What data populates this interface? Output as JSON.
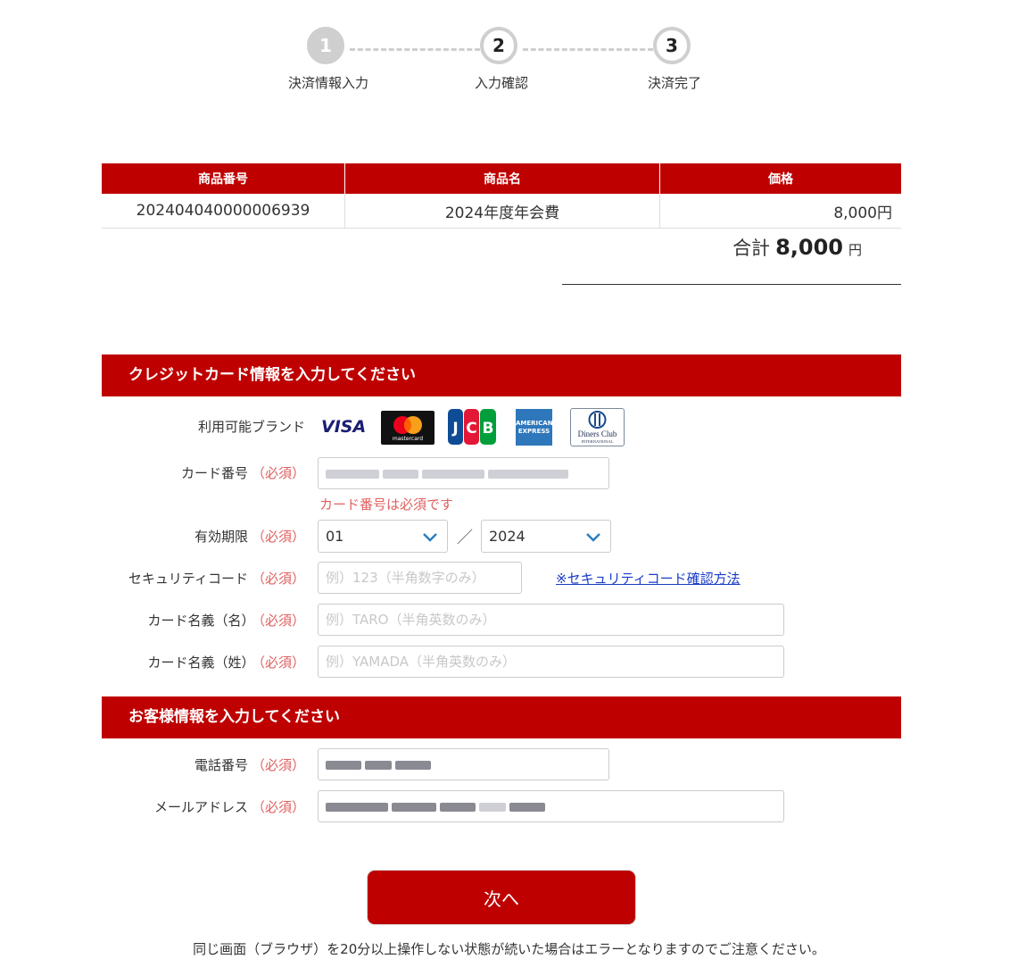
{
  "stepper": {
    "steps": [
      {
        "number": "1",
        "label": "決済情報入力"
      },
      {
        "number": "2",
        "label": "入力確認"
      },
      {
        "number": "3",
        "label": "決済完了"
      }
    ]
  },
  "product_table": {
    "headers": [
      "商品番号",
      "商品名",
      "価格"
    ],
    "rows": [
      [
        "202404040000006939",
        "2024年度年会費",
        "8,000円"
      ]
    ],
    "total_label": "合計",
    "total_value": "8,000",
    "total_unit": "円"
  },
  "card_section": {
    "title": "クレジットカード情報を入力してください",
    "brands_label": "利用可能ブランド",
    "brands": [
      "visa-logo",
      "mastercard-logo",
      "jcb-logo",
      "amex-logo",
      "diners-club-logo"
    ],
    "required_mark": "（必須）",
    "card_number_label": "カード番号",
    "card_number_error": "カード番号は必須です",
    "expiry_label": "有効期限",
    "expiry_month": "01",
    "expiry_separator": "／",
    "expiry_year": "2024",
    "security_label": "セキュリティコード",
    "security_placeholder": "例）123（半角数字のみ）",
    "security_link": "※セキュリティコード確認方法",
    "first_name_label": "カード名義（名）",
    "first_name_placeholder": "例）TARO（半角英数のみ）",
    "last_name_label": "カード名義（姓）",
    "last_name_placeholder": "例）YAMADA（半角英数のみ）"
  },
  "customer_section": {
    "title": "お客様情報を入力してください",
    "phone_label": "電話番号",
    "email_label": "メールアドレス",
    "required_mark": "（必須）"
  },
  "actions": {
    "next_label": "次へ"
  },
  "notice": "同じ画面（ブラウザ）を20分以上操作しない状態が続いた場合はエラーとなりますのでご注意ください。",
  "colors": {
    "accent": "#bf0000",
    "required": "#e06060",
    "link": "#1a3cc8",
    "step_inactive": "#cfcfcf"
  }
}
